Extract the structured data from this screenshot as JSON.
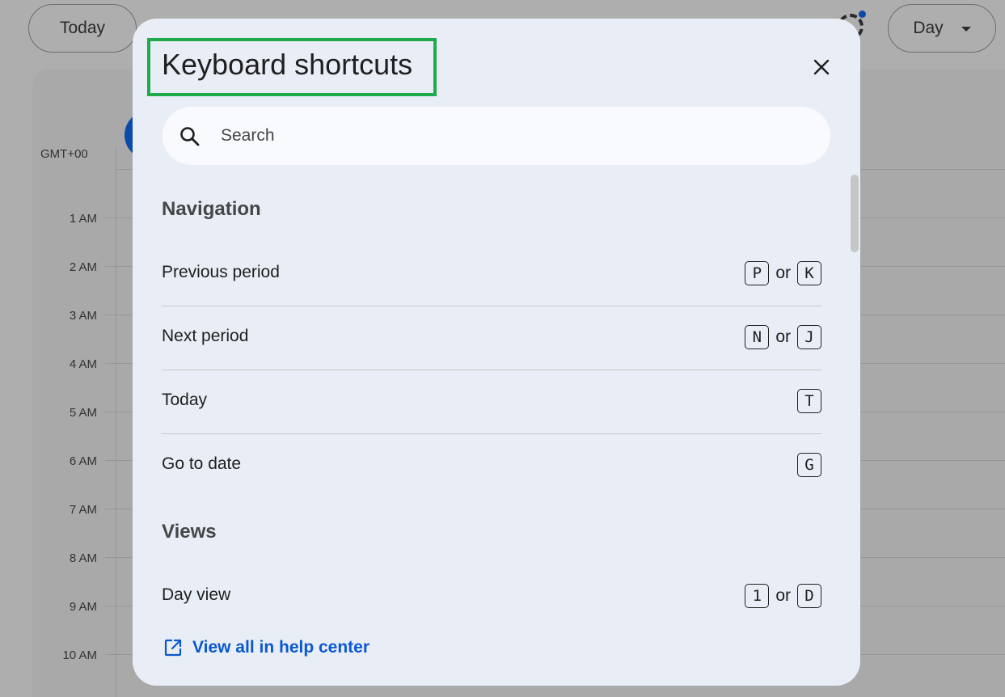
{
  "background": {
    "today_button": "Today",
    "view_button": "Day",
    "timezone": "GMT+00",
    "hours": [
      "1 AM",
      "2 AM",
      "3 AM",
      "4 AM",
      "5 AM",
      "6 AM",
      "7 AM",
      "8 AM",
      "9 AM",
      "10 AM"
    ]
  },
  "dialog": {
    "title": "Keyboard shortcuts",
    "search_placeholder": "Search",
    "sections": [
      {
        "title": "Navigation",
        "items": [
          {
            "label": "Previous period",
            "keys": [
              "P",
              "K"
            ],
            "separator": "or"
          },
          {
            "label": "Next period",
            "keys": [
              "N",
              "J"
            ],
            "separator": "or"
          },
          {
            "label": "Today",
            "keys": [
              "T"
            ]
          },
          {
            "label": "Go to date",
            "keys": [
              "G"
            ]
          }
        ]
      },
      {
        "title": "Views",
        "items": [
          {
            "label": "Day view",
            "keys": [
              "1",
              "D"
            ],
            "separator": "or"
          }
        ]
      }
    ],
    "help_link": "View all in help center"
  },
  "colors": {
    "highlight_box": "#1fab4b",
    "link": "#0b57d0",
    "dialog_bg": "#e9eef6"
  }
}
